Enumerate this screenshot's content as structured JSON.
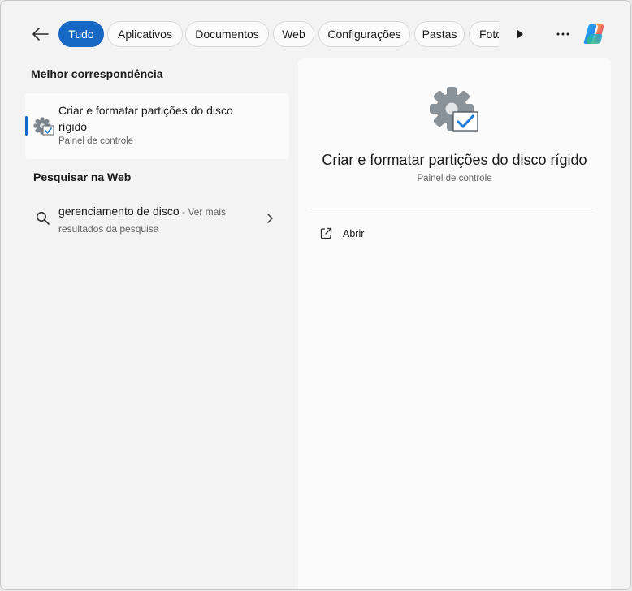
{
  "filters": {
    "chips": [
      {
        "label": "Tudo",
        "active": true
      },
      {
        "label": "Aplicativos",
        "active": false
      },
      {
        "label": "Documentos",
        "active": false
      },
      {
        "label": "Web",
        "active": false
      },
      {
        "label": "Configurações",
        "active": false
      },
      {
        "label": "Pastas",
        "active": false
      },
      {
        "label": "Fotc",
        "active": false
      }
    ],
    "back_icon": "arrow-left-icon",
    "more_filters_icon": "play-triangle-icon",
    "menu_icon": "ellipsis-icon",
    "copilot_icon": "copilot-logo-icon"
  },
  "best_match": {
    "heading": "Melhor correspondência",
    "title": "Criar e formatar partições do disco rígido",
    "subtitle": "Painel de controle",
    "icon": "gear-checkbox-icon"
  },
  "web_search": {
    "heading": "Pesquisar na Web",
    "query": "gerenciamento de disco",
    "hint": " - Ver mais resultados da pesquisa",
    "icon": "search-icon"
  },
  "detail": {
    "title": "Criar e formatar partições do disco rígido",
    "subtitle": "Painel de controle",
    "actions": [
      {
        "label": "Abrir",
        "icon": "open-external-icon"
      }
    ]
  },
  "colors": {
    "accent": "#1767c4",
    "background": "#f3f3f3",
    "panel": "#fbfbfb"
  }
}
